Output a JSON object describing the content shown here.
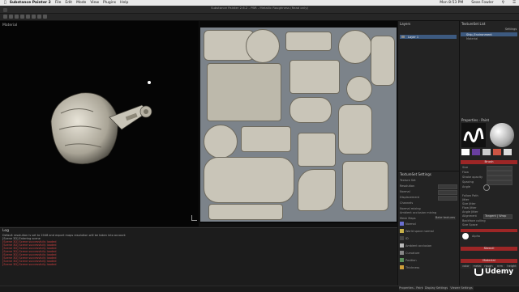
{
  "menubar": {
    "app": "Substance Painter 2",
    "items": [
      "File",
      "Edit",
      "Mode",
      "View",
      "Plugins",
      "Help"
    ],
    "clock": "Mon 8:53 PM",
    "user": "Sean Fowler"
  },
  "window_title": "Substance Painter 2.6.2 - PBR - Metallic Roughness (Read only)",
  "viewport_3d": {
    "label": "Material"
  },
  "log": {
    "title": "Log",
    "lines": [
      {
        "kind": "info",
        "text": "Default resolution is set to 2048 and export maps resolution will be taken into account"
      },
      {
        "kind": "info",
        "text": "[Scene 3D] Entering scene"
      },
      {
        "kind": "err",
        "text": "[Scene 3D] Scene successfully loaded"
      },
      {
        "kind": "err",
        "text": "[Scene 3D] Scene successfully loaded"
      },
      {
        "kind": "err",
        "text": "[Scene 3D] Scene successfully loaded"
      },
      {
        "kind": "err",
        "text": "[Scene 3D] Scene successfully loaded"
      },
      {
        "kind": "err",
        "text": "[Scene 3D] Scene successfully loaded"
      },
      {
        "kind": "err",
        "text": "[Scene 3D] Scene successfully loaded"
      },
      {
        "kind": "err",
        "text": "[Scene 3D] Scene successfully loaded"
      },
      {
        "kind": "err",
        "text": "[Scene 3D] Scene successfully loaded"
      }
    ]
  },
  "layers": {
    "title": "Layers",
    "items": [
      "Layer 1"
    ]
  },
  "texture_set_list": {
    "title": "TextureSet List",
    "settings": "Settings",
    "items": [
      "Ship_Environment"
    ],
    "shader": "Material"
  },
  "texture_set_settings": {
    "title": "TextureSet Settings",
    "rows": [
      "Texture Set",
      "Resolution",
      "Normal",
      "Displacement",
      "Channels",
      "Normal mixing",
      "Ambient occlusion mixing",
      "Mesh Maps"
    ],
    "button": "Bake textures",
    "maps": [
      "Normal",
      "World space normal",
      "ID",
      "Ambient occlusion",
      "Curvature",
      "Position",
      "Thickness"
    ]
  },
  "properties": {
    "title": "Properties - Paint",
    "brush_label": "Brush",
    "brush_rows": [
      "Size",
      "Flow",
      "Stroke opacity",
      "Spacing",
      "Angle",
      "Follow Path",
      "Jitter",
      "Size Jitter",
      "Flow Jitter",
      "Angle Jitter",
      "Position Jitter",
      "Alignment",
      "Backface culling",
      "Size Space"
    ],
    "alignment_value": "Tangent | Wrap",
    "alpha_label": "Alpha",
    "stencil_label": "Stencil",
    "material_label": "Material",
    "material_tabs": [
      "color",
      "metal",
      "rough",
      "nrm",
      "height"
    ]
  },
  "bottom_tabs": [
    "Properties - Paint",
    "Display Settings",
    "Viewer Settings"
  ],
  "udemy": "Udemy",
  "colors": {
    "accent_red": "#9d2626",
    "selection": "#3d5a80"
  }
}
